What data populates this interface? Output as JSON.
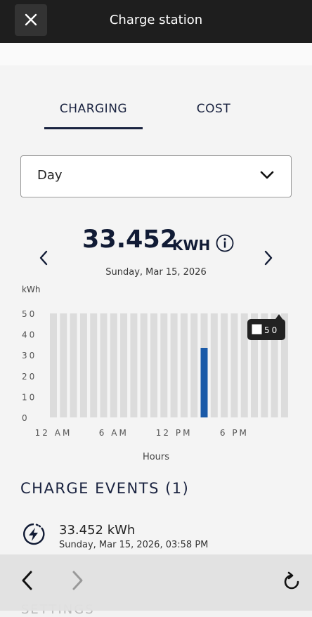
{
  "header": {
    "title": "Charge station"
  },
  "tabs": [
    {
      "label": "CHARGING",
      "active": true
    },
    {
      "label": "COST",
      "active": false
    }
  ],
  "period_select": {
    "value": "Day"
  },
  "summary": {
    "value": "33.452",
    "unit": "KWH",
    "date": "Sunday, Mar 15, 2026"
  },
  "chart_data": {
    "type": "bar",
    "ylabel": "kWh",
    "xlabel": "Hours",
    "ylim": [
      0,
      50
    ],
    "yticks": [
      "50",
      "40",
      "30",
      "20",
      "10",
      "0"
    ],
    "x_tick_labels": [
      "12 AM",
      "6 AM",
      "12 PM",
      "6 PM"
    ],
    "categories": [
      "0",
      "1",
      "2",
      "3",
      "4",
      "5",
      "6",
      "7",
      "8",
      "9",
      "10",
      "11",
      "12",
      "13",
      "14",
      "15",
      "16",
      "17",
      "18",
      "19",
      "20",
      "21",
      "22",
      "23"
    ],
    "values": [
      0,
      0,
      0,
      0,
      0,
      0,
      0,
      0,
      0,
      0,
      0,
      0,
      0,
      0,
      0,
      33.452,
      0,
      0,
      0,
      0,
      0,
      0,
      0,
      0
    ],
    "tooltip": "50",
    "bar_color": "#1a5aa8",
    "background_bar_color": "#dcdcdc"
  },
  "events": {
    "title": "CHARGE EVENTS (1)",
    "items": [
      {
        "kwh": "33.452 kWh",
        "date": "Sunday, Mar 15, 2026, 03:58 PM"
      }
    ]
  },
  "settings_peek": "SETTINGS",
  "icons": {
    "close": "close-icon",
    "chevron": "chevron-down-icon",
    "info": "info-icon",
    "event": "charging-bolt-icon",
    "back": "back-arrow-icon",
    "forward": "forward-arrow-icon",
    "reload": "reload-icon"
  }
}
